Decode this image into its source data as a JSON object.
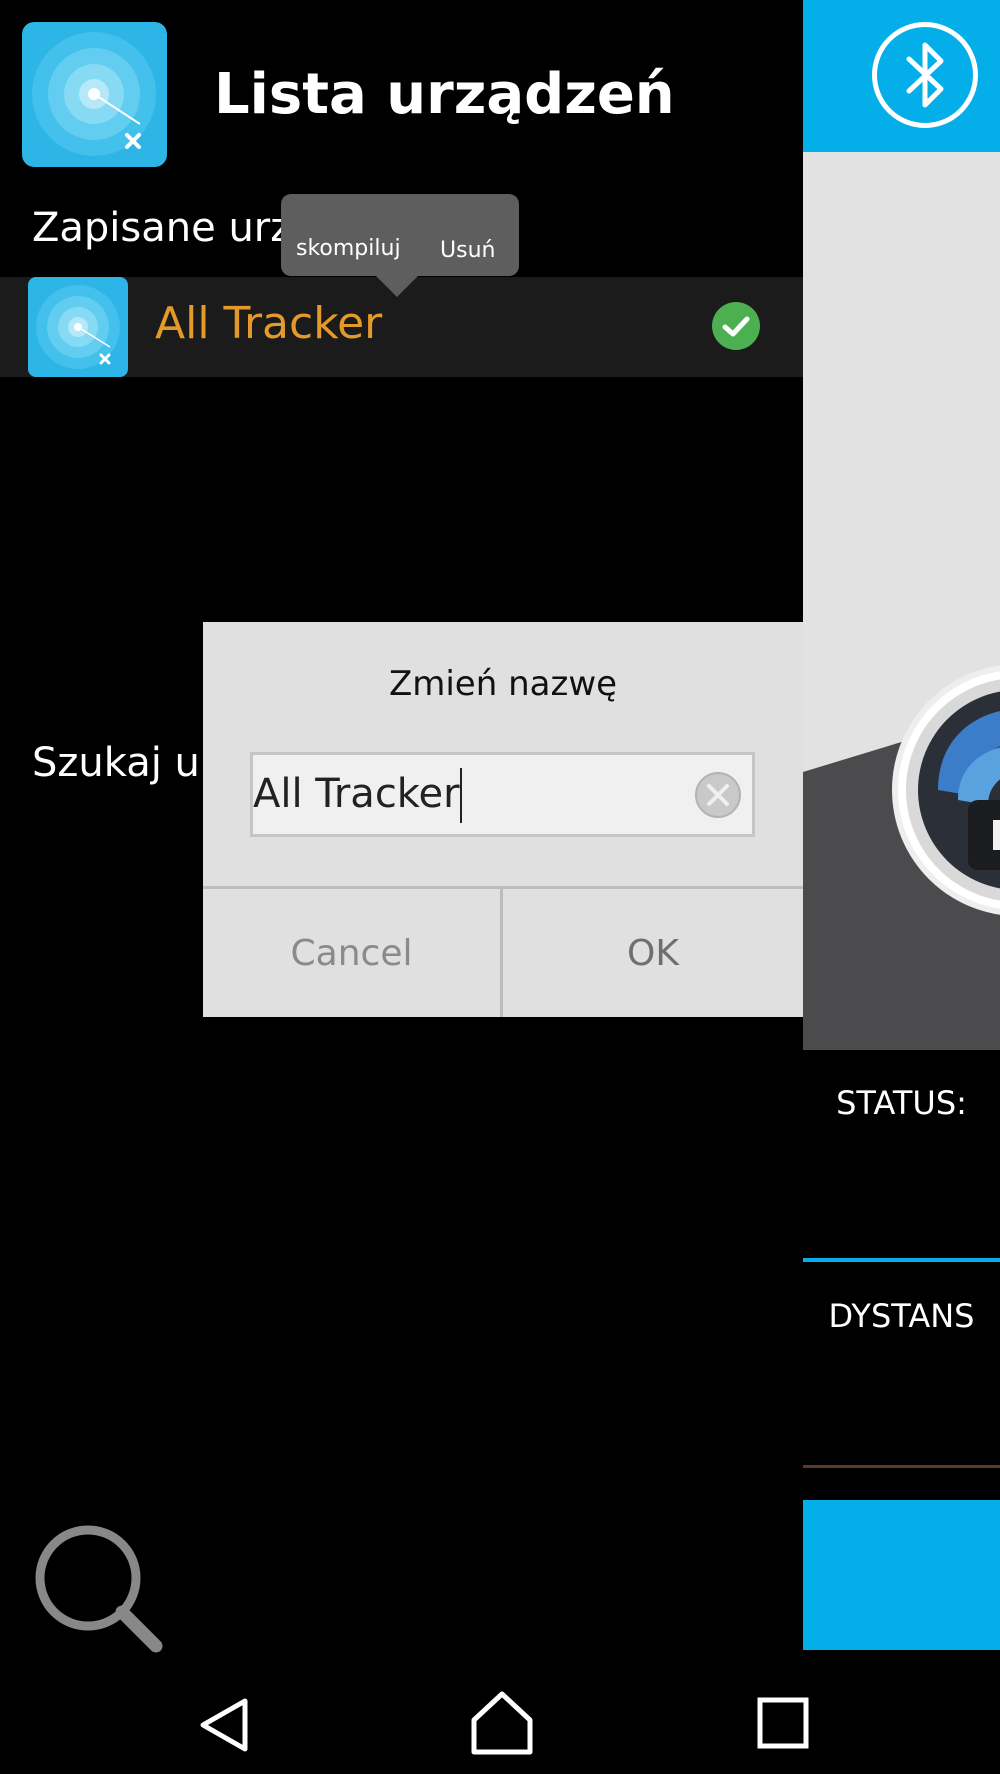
{
  "drawer": {
    "title": "Lista urządzeń",
    "saved_section_label": "Zapisane urza",
    "search_section_label": "Szukaj urz",
    "saved_devices": [
      {
        "name": "All Tracker",
        "connected": true
      }
    ]
  },
  "context_popup": {
    "edit_label": "skompiluj",
    "delete_label": "Usuń"
  },
  "rename_dialog": {
    "title": "Zmień nazwę",
    "input_value": "All Tracker",
    "cancel_label": "Cancel",
    "ok_label": "OK"
  },
  "main_panel": {
    "status_label": "STATUS:",
    "distance_label": "DYSTANS"
  },
  "colors": {
    "accent": "#04aee9",
    "device_name": "#e49a2a",
    "connected_check": "#4caf50"
  },
  "icons": {
    "app": "radar-icon",
    "bluetooth": "bluetooth-icon",
    "connected": "check-circle-icon",
    "clear": "clear-icon",
    "search": "search-icon",
    "nav_back": "back-icon",
    "nav_home": "home-icon",
    "nav_recents": "recents-icon"
  }
}
